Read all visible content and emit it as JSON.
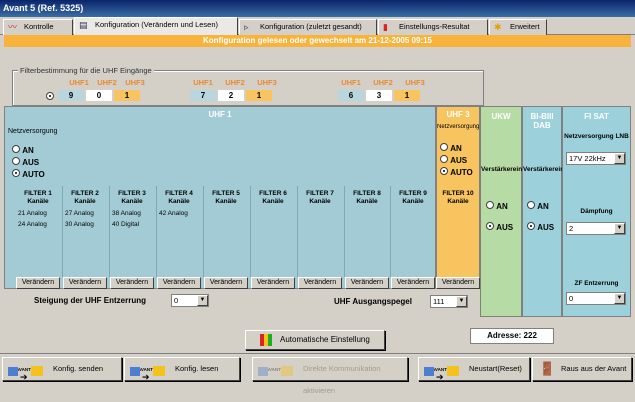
{
  "window": {
    "title": "Avant 5 (Ref. 5325)"
  },
  "tabs": [
    {
      "label": "Kontrolle",
      "icon": "wave-icon"
    },
    {
      "label": "Konfiguration (Verändern und Lesen)",
      "icon": "document-icon"
    },
    {
      "label": "Konfiguration (zuletzt gesandt)",
      "icon": "send-document-icon"
    },
    {
      "label": "Einstellungs-Resultat",
      "icon": "bar-chart-icon"
    },
    {
      "label": "Erweitert",
      "icon": "star-icon"
    }
  ],
  "banner": "Konfiguration gelesen oder gewechselt am 21-12-2005 09:15",
  "filter_group": {
    "legend": "Filterbestimmung für die UHF Eingänge",
    "headers": [
      "UHF1",
      "UHF2",
      "UHF3"
    ],
    "options": [
      {
        "values": [
          "9",
          "0",
          "1"
        ],
        "selected": true
      },
      {
        "values": [
          "7",
          "2",
          "1"
        ],
        "selected": false
      },
      {
        "values": [
          "6",
          "3",
          "1"
        ],
        "selected": false
      }
    ]
  },
  "uhf1": {
    "title": "UHF 1",
    "power_label": "Netzversorgung",
    "power_options": [
      "AN",
      "AUS",
      "AUTO"
    ],
    "power_selected": "AUTO",
    "filters": [
      {
        "name": "FILTER 1",
        "sub": "Kanäle",
        "lines": [
          "21 Analog",
          "24 Analog"
        ]
      },
      {
        "name": "FILTER 2",
        "sub": "Kanäle",
        "lines": [
          "27 Analog",
          "30 Analog"
        ]
      },
      {
        "name": "FILTER 3",
        "sub": "Kanäle",
        "lines": [
          "38 Analog",
          "40 Digital"
        ]
      },
      {
        "name": "FILTER 4",
        "sub": "Kanäle",
        "lines": [
          "42 Analog"
        ]
      },
      {
        "name": "FILTER 5",
        "sub": "Kanäle",
        "lines": []
      },
      {
        "name": "FILTER 6",
        "sub": "Kanäle",
        "lines": []
      },
      {
        "name": "FILTER 7",
        "sub": "Kanäle",
        "lines": []
      },
      {
        "name": "FILTER 8",
        "sub": "Kanäle",
        "lines": []
      },
      {
        "name": "FILTER 9",
        "sub": "Kanäle",
        "lines": []
      },
      {
        "name": "FILTER 10",
        "sub": "Kanäle",
        "lines": []
      }
    ],
    "edit_label": "Verändern"
  },
  "uhf3": {
    "title": "UHF 3",
    "power_label": "Netzversorgung",
    "power_options": [
      "AN",
      "AUS",
      "AUTO"
    ],
    "power_selected": "AUTO"
  },
  "ukw": {
    "title": "UKW",
    "amp_label": "Verstärkereingang",
    "options": [
      "AN",
      "AUS"
    ],
    "selected": "AUS"
  },
  "bi": {
    "title": "BI-BIII DAB",
    "amp_label": "Verstärkereingang",
    "options": [
      "AN",
      "AUS"
    ],
    "selected": "AUS"
  },
  "fisat": {
    "title": "FI SAT",
    "lnb_label": "Netzversorgung LNB",
    "lnb_value": "17V 22kHz",
    "damping_label": "Dämpfung",
    "damping_value": "2",
    "zf_label": "ZF Entzerrung",
    "zf_value": "0"
  },
  "slope": {
    "label": "Steigung der UHF Entzerrung",
    "value": "0"
  },
  "output": {
    "label": "UHF Ausgangspegel",
    "value": "111"
  },
  "auto_button": "Automatische Einstellung",
  "address": "Adresse: 222",
  "bottom": {
    "logo_text": "AVANT",
    "buttons": [
      {
        "label": "Konfig. senden",
        "enabled": true
      },
      {
        "label": "Konfig. lesen",
        "enabled": true
      },
      {
        "label": "Direkte Kommunikation aktivieren",
        "enabled": false
      },
      {
        "label": "Neustart(Reset)",
        "enabled": true
      },
      {
        "label": "Raus aus der Avant",
        "enabled": true
      }
    ]
  },
  "colors": {
    "uhf_panel": "#a2cbd6",
    "uhf3_panel": "#f8c460",
    "ukw_panel": "#b6dba5",
    "sat_panel": "#9cd1dc",
    "banner": "#f7b33b"
  }
}
